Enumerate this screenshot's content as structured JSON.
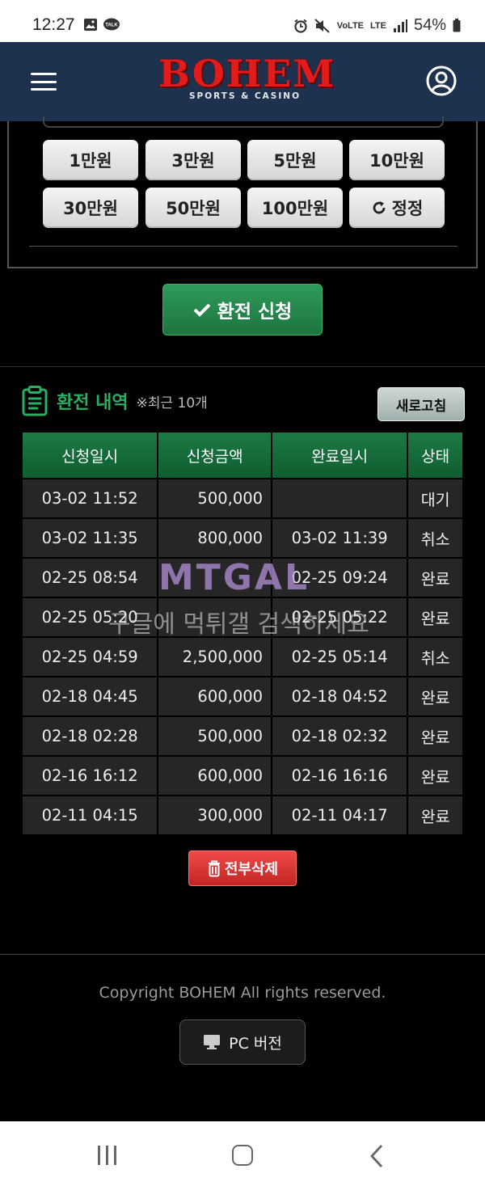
{
  "status_bar": {
    "time": "12:27",
    "battery": "54%",
    "network": "LTE",
    "volte": "VoLTE"
  },
  "header": {
    "brand": "BOHEM",
    "tagline": "SPORTS & CASINO"
  },
  "amount_buttons": [
    "1만원",
    "3만원",
    "5만원",
    "10만원",
    "30만원",
    "50만원",
    "100만원",
    "정정"
  ],
  "apply_button": "환전 신청",
  "history": {
    "title": "환전 내역",
    "note": "※최근 10개",
    "refresh_label": "새로고침",
    "columns": [
      "신청일시",
      "신청금액",
      "완료일시",
      "상태"
    ],
    "rows": [
      [
        "03-02 11:52",
        "500,000",
        "",
        "대기"
      ],
      [
        "03-02 11:35",
        "800,000",
        "03-02 11:39",
        "취소"
      ],
      [
        "02-25 08:54",
        "",
        "02-25 09:24",
        "완료"
      ],
      [
        "02-25 05:20",
        "",
        "02-25 05:22",
        "완료"
      ],
      [
        "02-25 04:59",
        "2,500,000",
        "02-25 05:14",
        "취소"
      ],
      [
        "02-18 04:45",
        "600,000",
        "02-18 04:52",
        "완료"
      ],
      [
        "02-18 02:28",
        "500,000",
        "02-18 02:32",
        "완료"
      ],
      [
        "02-16 16:12",
        "600,000",
        "02-16 16:16",
        "완료"
      ],
      [
        "02-11 04:15",
        "300,000",
        "02-11 04:17",
        "완료"
      ]
    ],
    "delete_all_label": "전부삭제"
  },
  "watermark": {
    "logo": "MTGAL",
    "text": "구글에 먹튀갤 검색하세요"
  },
  "footer": {
    "copyright": "Copyright BOHEM All rights reserved.",
    "pc_version_label": "PC 버전"
  },
  "colors": {
    "header_bg": "#1e3250",
    "brand_red": "#e21b1b",
    "accent_green": "#1c7a44",
    "delete_red": "#d63232"
  }
}
